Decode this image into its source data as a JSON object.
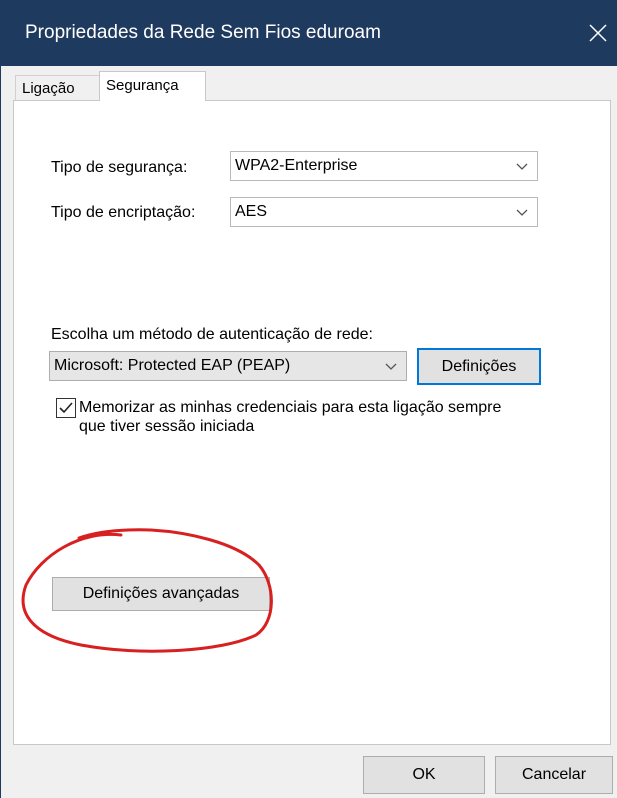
{
  "window": {
    "title": "Propriedades da Rede Sem Fios eduroam",
    "close_glyph": "✕"
  },
  "tabs": [
    {
      "label": "Ligação",
      "selected": false
    },
    {
      "label": "Segurança",
      "selected": true
    }
  ],
  "security": {
    "type_label": "Tipo de segurança:",
    "type_value": "WPA2-Enterprise",
    "encryption_label": "Tipo de encriptação:",
    "encryption_value": "AES"
  },
  "auth": {
    "label": "Escolha um método de autenticação de rede:",
    "method_value": "Microsoft: Protected EAP (PEAP)",
    "settings_button": "Definições",
    "remember_checked": true,
    "remember_label_line1": "Memorizar as minhas credenciais para esta ligação sempre",
    "remember_label_line2": "que tiver sessão iniciada"
  },
  "advanced_button": "Definições avançadas",
  "footer": {
    "ok": "OK",
    "cancel": "Cancelar"
  },
  "colors": {
    "titlebar": "#1e3a5f",
    "accent": "#0078d7",
    "annotation": "#d92020"
  }
}
